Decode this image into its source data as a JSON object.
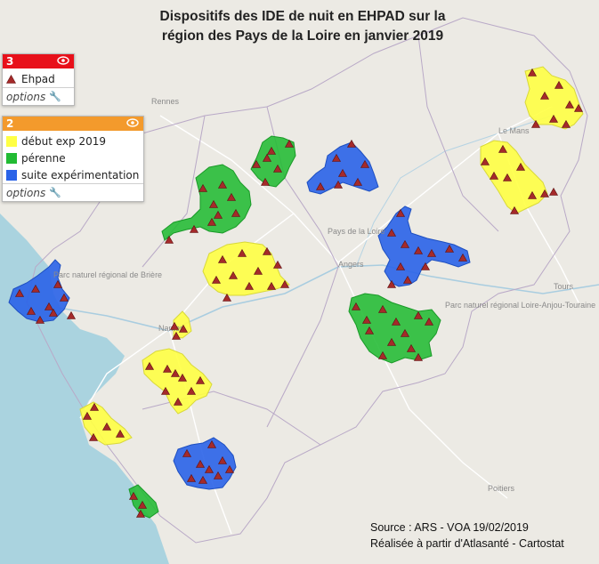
{
  "title": {
    "line1": "Dispositifs des IDE de nuit en EHPAD sur la",
    "line2": "région des Pays de la Loire en janvier 2019"
  },
  "legend_points": {
    "number": "3",
    "color": "#e8101a",
    "item_label": "Ehpad",
    "options_label": "options",
    "icons": [
      "eye-icon",
      "wrench-icon"
    ]
  },
  "legend_zones": {
    "number": "2",
    "color": "#f39a2c",
    "items": [
      {
        "label": "début exp 2019",
        "color": "#ffff44"
      },
      {
        "label": "pérenne",
        "color": "#22bb33"
      },
      {
        "label": "suite expérimentation",
        "color": "#2a63e8"
      }
    ],
    "options_label": "options"
  },
  "map": {
    "place_labels": [
      "Rennes",
      "Le Mans",
      "Pays de la Loire",
      "Angers",
      "Nantes",
      "Tours",
      "Parc naturel régional Loire-Anjou-Touraine",
      "Poitiers",
      "Parc naturel régional de Brière"
    ],
    "sea_color": "#aad3df",
    "land_color": "#eceae4"
  },
  "source": {
    "line1": "Source : ARS - VOA 19/02/2019",
    "line2": "Réalisée à partir d'Atlasanté - Cartostat"
  }
}
